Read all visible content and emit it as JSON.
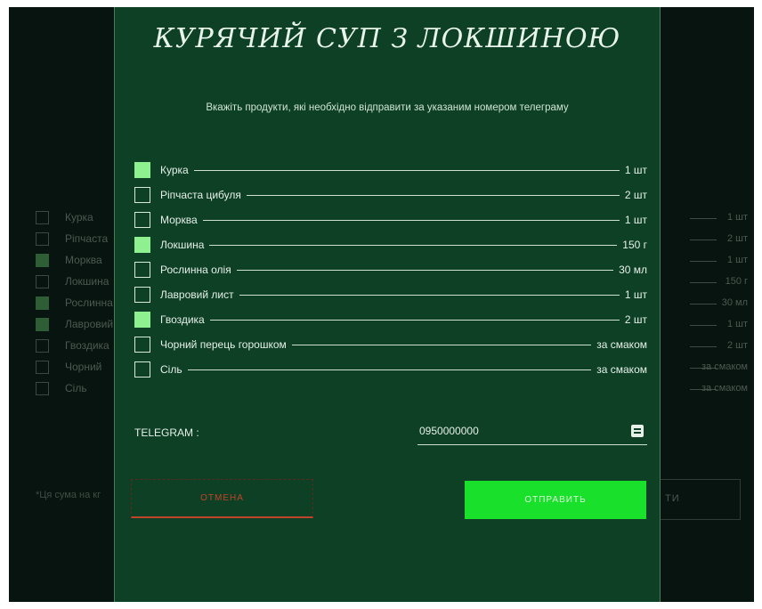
{
  "modal": {
    "title": "КУРЯЧИЙ СУП З ЛОКШИНОЮ",
    "subtitle": "Вкажіть продукти, які необхідно відправити за указаним номером телеграму",
    "items": [
      {
        "name": "Курка",
        "qty": "1 шт",
        "checked": true
      },
      {
        "name": "Ріпчаста цибуля",
        "qty": "2 шт",
        "checked": false
      },
      {
        "name": "Морква",
        "qty": "1 шт",
        "checked": false
      },
      {
        "name": "Локшина",
        "qty": "150 г",
        "checked": true
      },
      {
        "name": "Рослинна олія",
        "qty": "30 мл",
        "checked": false
      },
      {
        "name": "Лавровий лист",
        "qty": "1 шт",
        "checked": false
      },
      {
        "name": "Гвоздика",
        "qty": "2 шт",
        "checked": true
      },
      {
        "name": "Чорний перець горошком",
        "qty": "за смаком",
        "checked": false
      },
      {
        "name": "Сіль",
        "qty": "за смаком",
        "checked": false
      }
    ],
    "telegram_label": "TELEGRAM :",
    "telegram_value": "0950000000",
    "cancel_label": "ОТМЕНА",
    "send_label": "ОТПРАВИТЬ"
  },
  "background": {
    "items": [
      {
        "name": "Курка",
        "qty": "1 шт",
        "checked": false
      },
      {
        "name": "Ріпчаста",
        "qty": "2 шт",
        "checked": false
      },
      {
        "name": "Морква",
        "qty": "1 шт",
        "checked": true
      },
      {
        "name": "Локшина",
        "qty": "150 г",
        "checked": false
      },
      {
        "name": "Рослинна",
        "qty": "30 мл",
        "checked": true
      },
      {
        "name": "Лавровий",
        "qty": "1 шт",
        "checked": true
      },
      {
        "name": "Гвоздика",
        "qty": "2 шт",
        "checked": false
      },
      {
        "name": "Чорний",
        "qty": "за смаком",
        "checked": false
      },
      {
        "name": "Сіль",
        "qty": "за смаком",
        "checked": false
      }
    ],
    "note": "*Ця сума на кг",
    "button_label": "ТИ"
  },
  "colors": {
    "modal_bg": "#0d4024",
    "checked": "#8ff08f",
    "send_button": "#19e02a",
    "cancel_accent": "#c0442a"
  }
}
